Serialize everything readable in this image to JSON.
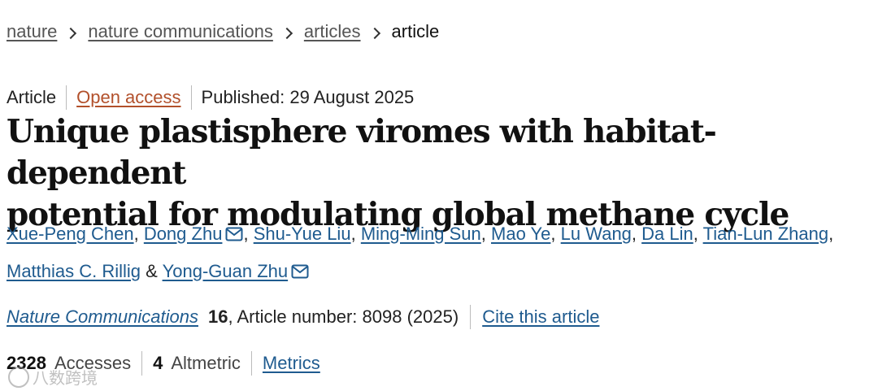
{
  "breadcrumb": {
    "items": [
      "nature",
      "nature communications",
      "articles"
    ],
    "current": "article"
  },
  "meta": {
    "type": "Article",
    "access": "Open access",
    "published": "Published: 29 August 2025"
  },
  "title": {
    "line1": "Unique plastisphere viromes with habitat-dependent",
    "line2": "potential for modulating global methane cycle"
  },
  "authors": {
    "list": [
      "Xue-Peng Chen",
      "Dong Zhu",
      "Shu-Yue Liu",
      "Ming-Ming Sun",
      "Mao Ye",
      "Lu Wang",
      "Da Lin",
      "Tian-Lun Zhang",
      "Matthias C. Rillig",
      "Yong-Guan Zhu"
    ],
    "ampersand": "&",
    "comma": ","
  },
  "citation": {
    "journal": "Nature Communications",
    "volume": "16",
    "article_number": ", Article number: 8098 (2025)",
    "cite_link": "Cite this article"
  },
  "metrics": {
    "accesses_count": "2328",
    "accesses_label": "Accesses",
    "altmetric_count": "4",
    "altmetric_label": "Altmetric",
    "metrics_link": "Metrics"
  },
  "watermark": {
    "text": "八数跨境"
  },
  "colors": {
    "link": "#1f5b8f",
    "open_access": "#b2502b",
    "title": "#111111"
  }
}
